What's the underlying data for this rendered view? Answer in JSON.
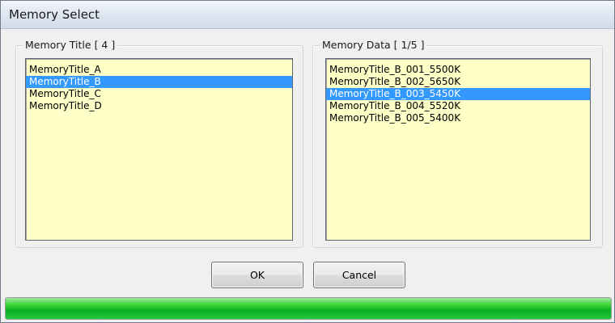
{
  "window": {
    "title": "Memory Select"
  },
  "memory_title_group": {
    "label": "Memory Title [ 4 ]",
    "items": [
      "MemoryTitle_A",
      "MemoryTitle_B",
      "MemoryTitle_C",
      "MemoryTitle_D"
    ],
    "selected_index": 1
  },
  "memory_data_group": {
    "label": "Memory Data [ 1/5 ]",
    "items": [
      "MemoryTitle_B_001_5500K",
      "MemoryTitle_B_002_5650K",
      "MemoryTitle_B_003_5450K",
      "MemoryTitle_B_004_5520K",
      "MemoryTitle_B_005_5400K"
    ],
    "selected_index": 2
  },
  "buttons": {
    "ok_label": "OK",
    "cancel_label": "Cancel"
  },
  "progress": {
    "fraction": 1.0
  },
  "colors": {
    "list_background": "#ffffc8",
    "selection": "#3399ff",
    "progress_green": "#06b025"
  }
}
